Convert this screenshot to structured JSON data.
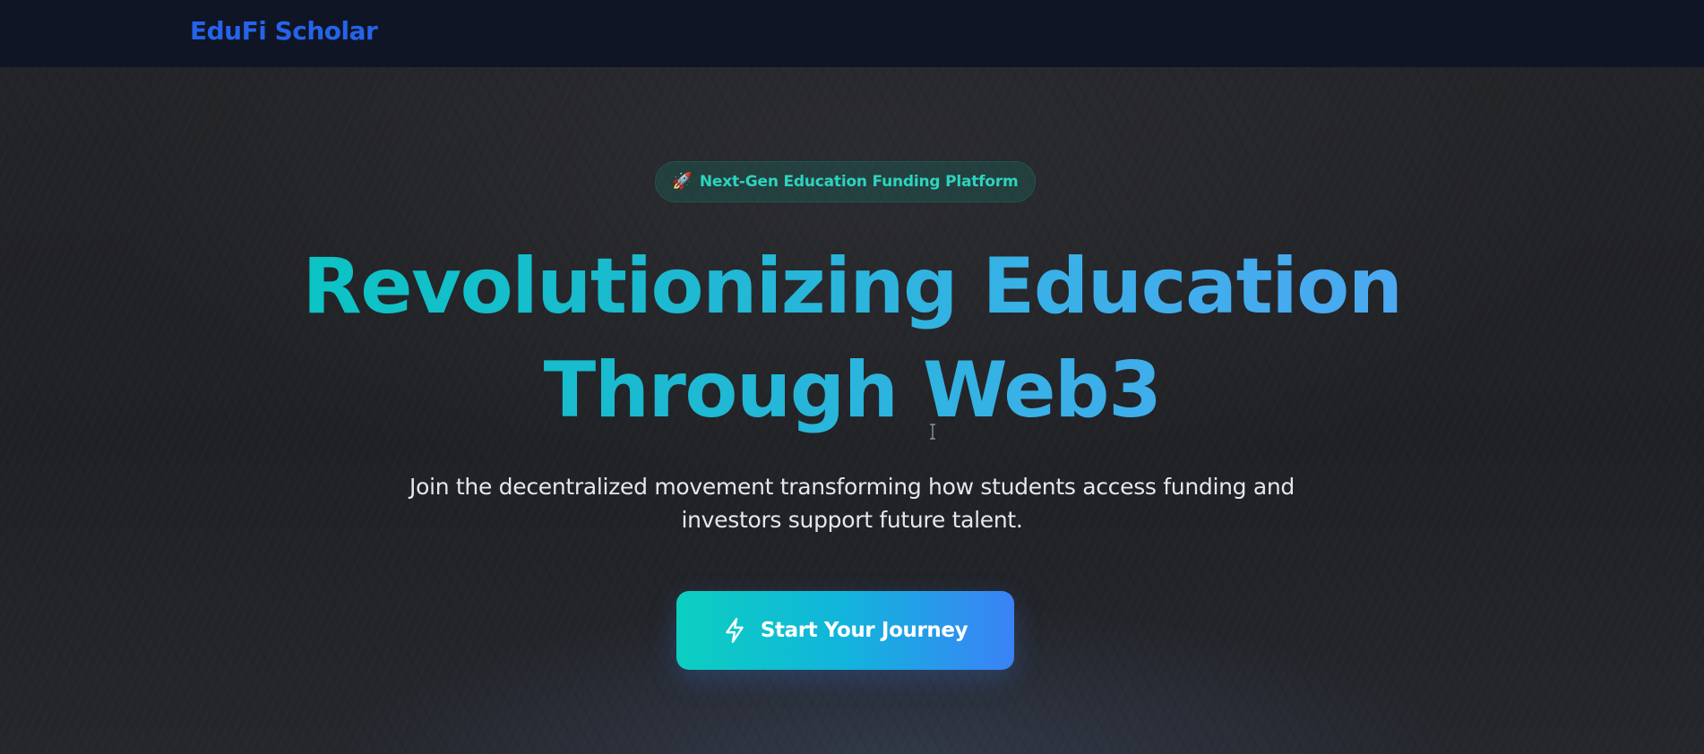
{
  "navbar": {
    "brand": "EduFi Scholar"
  },
  "hero": {
    "badge": {
      "icon": "rocket-icon",
      "icon_glyph": "🚀",
      "label": "Next-Gen Education Funding Platform"
    },
    "headline": {
      "line1": "Revolutionizing Education",
      "line2": "Through Web3"
    },
    "subtitle": "Join the decentralized movement transforming how students access funding and investors support future talent.",
    "cta": {
      "icon": "lightning-icon",
      "label": "Start Your Journey"
    }
  },
  "colors": {
    "brand": "#2563eb",
    "nav_background": "#0f1524",
    "page_background": "#1e2024",
    "badge_text": "#2dd4bf",
    "headline_gradient_start": "#06c7c0",
    "headline_gradient_end": "#52a6f4",
    "cta_gradient_start": "#0ccfc0",
    "cta_gradient_end": "#3b82f6",
    "subtitle_text": "#e5e7eb"
  }
}
